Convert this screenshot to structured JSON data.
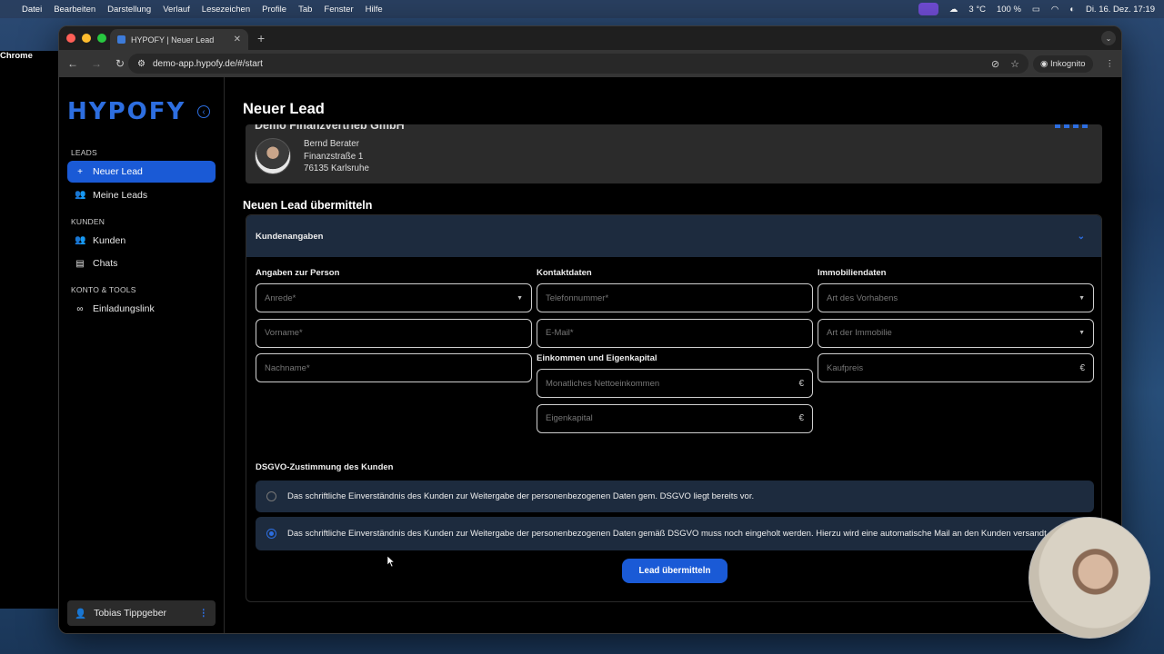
{
  "menubar": {
    "app": "Chrome",
    "items": [
      "Datei",
      "Bearbeiten",
      "Darstellung",
      "Verlauf",
      "Lesezeichen",
      "Profile",
      "Tab",
      "Fenster",
      "Hilfe"
    ],
    "weather": "3 °C",
    "battery": "100 %",
    "datetime": "Di. 16. Dez.  17:19"
  },
  "browser": {
    "tab_title": "HYPOFY | Neuer Lead",
    "url": "demo-app.hypofy.de/#/start",
    "incognito_label": "Inkognito"
  },
  "sidebar": {
    "logo": "HYPOFY",
    "sections": {
      "leads": "LEADS",
      "kunden": "KUNDEN",
      "konto": "KONTO & TOOLS"
    },
    "items": {
      "neuer_lead": "Neuer Lead",
      "meine_leads": "Meine Leads",
      "kunden": "Kunden",
      "chats": "Chats",
      "einladungslink": "Einladungslink"
    },
    "user": "Tobias Tippgeber"
  },
  "main": {
    "page_title": "Neuer Lead",
    "advisor": {
      "company": "Demo Finanzvertrieb GmbH",
      "name": "Bernd Berater",
      "street": "Finanzstraße 1",
      "city": "76135 Karlsruhe"
    },
    "form_title": "Neuen Lead übermitteln",
    "accordion_title": "Kundenangaben",
    "person": {
      "heading": "Angaben zur Person",
      "anrede": "Anrede*",
      "vorname": "Vorname*",
      "nachname": "Nachname*"
    },
    "kontakt": {
      "heading": "Kontaktdaten",
      "telefon": "Telefonnummer*",
      "email": "E-Mail*"
    },
    "einkommen": {
      "heading": "Einkommen und Eigenkapital",
      "netto": "Monatliches Nettoeinkommen",
      "eigenkapital": "Eigenkapital",
      "currency": "€"
    },
    "immobilie": {
      "heading": "Immobiliendaten",
      "vorhaben": "Art des Vorhabens",
      "immobilie": "Art der Immobilie",
      "kaufpreis": "Kaufpreis",
      "currency": "€"
    },
    "dsgvo": {
      "heading": "DSGVO-Zustimmung des Kunden",
      "option1": "Das schriftliche Einverständnis des Kunden zur Weitergabe der personenbezogenen Daten gem. DSGVO liegt bereits vor.",
      "option2": "Das schriftliche Einverständnis des Kunden zur Weitergabe der personenbezogenen Daten gemäß DSGVO muss noch eingeholt werden. Hierzu wird eine automatische Mail an den Kunden versandt.",
      "selected": 2
    },
    "submit_label": "Lead übermitteln"
  },
  "colors": {
    "accent": "#1a5ad6",
    "panel": "#1d2b3e",
    "background": "#000000"
  }
}
